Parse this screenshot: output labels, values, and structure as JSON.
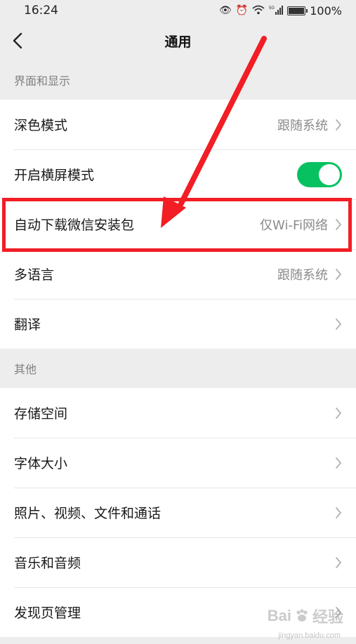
{
  "status_bar": {
    "time": "16:24",
    "battery_percent": "100%",
    "icons": [
      "eye-icon",
      "alarm-icon",
      "wifi-icon",
      "5g-signal-icon",
      "battery-icon"
    ]
  },
  "nav": {
    "title": "通用",
    "back_icon": "chevron-left-icon"
  },
  "sections": {
    "display": {
      "header": "界面和显示",
      "items": {
        "dark_mode": {
          "label": "深色模式",
          "value": "跟随系统"
        },
        "landscape": {
          "label": "开启横屏模式",
          "toggle_on": true
        },
        "auto_download": {
          "label": "自动下载微信安装包",
          "value": "仅Wi-Fi网络"
        },
        "language": {
          "label": "多语言",
          "value": "跟随系统"
        },
        "translate": {
          "label": "翻译"
        }
      }
    },
    "other": {
      "header": "其他",
      "items": {
        "storage": {
          "label": "存储空间"
        },
        "font_size": {
          "label": "字体大小"
        },
        "media": {
          "label": "照片、视频、文件和通话"
        },
        "music": {
          "label": "音乐和音频"
        },
        "discover": {
          "label": "发现页管理"
        }
      }
    }
  },
  "annotation": {
    "color": "#f21d25"
  },
  "watermark": {
    "brand": "Bai",
    "suffix": "经验",
    "url": "jingyan.baidu.com"
  },
  "colors": {
    "accent": "#07c160",
    "background": "#ededed",
    "annotation": "#f21d25"
  }
}
